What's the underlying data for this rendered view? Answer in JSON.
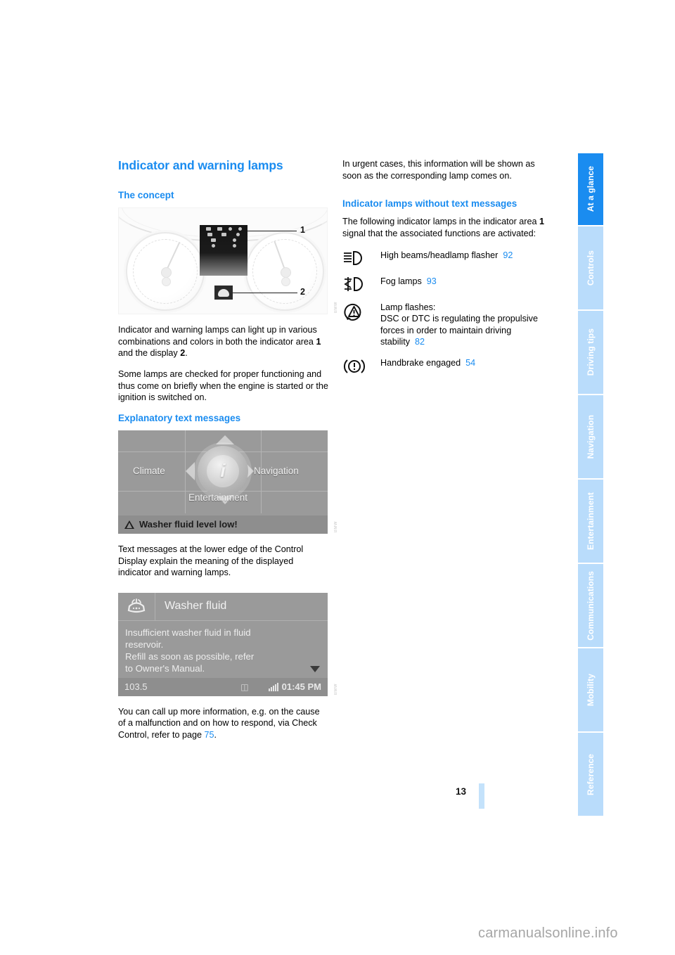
{
  "page": {
    "number": "13",
    "watermark": "carmanualsonline.info"
  },
  "left_column": {
    "title": "Indicator and warning lamps",
    "section_concept": {
      "heading": "The concept",
      "figure": {
        "name": "instrument-cluster-illustration",
        "callouts": [
          "1",
          "2"
        ]
      },
      "paragraph_1_a": "Indicator and warning lamps can light up in various combinations and colors in both the indicator area ",
      "paragraph_1_b": "1",
      "paragraph_1_c": " and the display ",
      "paragraph_1_d": "2",
      "paragraph_1_e": ".",
      "paragraph_2": "Some lamps are checked for proper functioning and thus come on briefly when the engine is started or the ignition is switched on."
    },
    "section_explanatory": {
      "heading": "Explanatory text messages",
      "control_display_1": {
        "menu_climate": "Climate",
        "menu_navigation": "Navigation",
        "menu_entertainment": "Entertainment",
        "center_icon": "i",
        "status_message": "Washer fluid level low!"
      },
      "paragraph_1": "Text messages at the lower edge of the Control Display explain the meaning of the displayed indicator and warning lamps.",
      "control_display_2": {
        "header_title": "Washer fluid",
        "message_line_1": "Insufficient washer fluid in fluid",
        "message_line_2": "reservoir.",
        "message_line_3": "Refill as soon as possible, refer",
        "message_line_4": "to Owner's Manual.",
        "status_frequency": "103.5",
        "status_time": "01:45 PM"
      },
      "paragraph_2_a": "You can call up more information, e.g. on the cause of a malfunction and on how to respond, via Check Control, refer to page ",
      "paragraph_2_ref": "75",
      "paragraph_2_b": "."
    }
  },
  "right_column": {
    "intro_paragraph": "In urgent cases, this information will be shown as soon as the corresponding lamp comes on.",
    "section_heading": "Indicator lamps without text messages",
    "section_intro_a": "The following indicator lamps in the indicator area ",
    "section_intro_b": "1",
    "section_intro_c": " signal that the associated functions are activated:",
    "lamps": [
      {
        "icon": "high-beam-icon",
        "label": "High beams/headlamp flasher",
        "page_ref": "92"
      },
      {
        "icon": "fog-lamp-icon",
        "label": "Fog lamps",
        "page_ref": "93"
      },
      {
        "icon": "dsc-warning-triangle-icon",
        "label_line_1": "Lamp flashes:",
        "label_line_2": "DSC or DTC is regulating the propulsive forces in order to maintain driving stability",
        "page_ref": "82"
      },
      {
        "icon": "handbrake-icon",
        "label": "Handbrake engaged",
        "page_ref": "54"
      }
    ]
  },
  "sidebar": {
    "tabs": [
      {
        "label": "At a glance",
        "active": true
      },
      {
        "label": "Controls",
        "active": false
      },
      {
        "label": "Driving tips",
        "active": false
      },
      {
        "label": "Navigation",
        "active": false
      },
      {
        "label": "Entertainment",
        "active": false
      },
      {
        "label": "Communications",
        "active": false
      },
      {
        "label": "Mobility",
        "active": false
      },
      {
        "label": "Reference",
        "active": false
      }
    ]
  },
  "colors": {
    "accent_blue": "#1a8cf0",
    "tab_inactive": "#b9dcfb",
    "page_bar": "#c4e2fb"
  }
}
